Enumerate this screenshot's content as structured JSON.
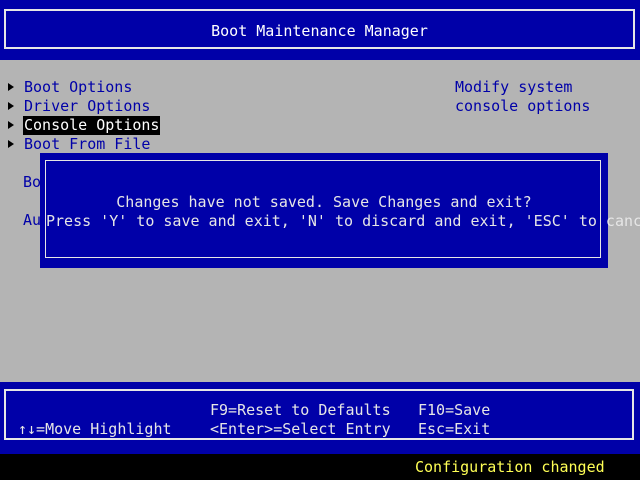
{
  "header": {
    "title": "Boot Maintenance Manager"
  },
  "menu": {
    "items": [
      {
        "label": "Boot Options",
        "selected": false
      },
      {
        "label": "Driver Options",
        "selected": false
      },
      {
        "label": "Console Options",
        "selected": true
      },
      {
        "label": "Boot From File",
        "selected": false
      }
    ],
    "partial_labels": [
      "Bo",
      "Au"
    ]
  },
  "help": {
    "text": "Modify system console options"
  },
  "dialog": {
    "line1": "Changes have not saved. Save Changes and exit?",
    "line2": "Press 'Y' to save and exit, 'N' to discard and exit, 'ESC' to cancel."
  },
  "footer": {
    "move_highlight": "↑↓=Move Highlight",
    "reset_defaults": "F9=Reset to Defaults",
    "select_entry": "<Enter>=Select Entry",
    "save": "F10=Save",
    "exit": "Esc=Exit"
  },
  "status": {
    "text": "Configuration changed"
  },
  "colors": {
    "blue": "#0000a8",
    "gray": "#b4b4b4",
    "white": "#e6e6e6",
    "yellow": "#ffff55"
  }
}
